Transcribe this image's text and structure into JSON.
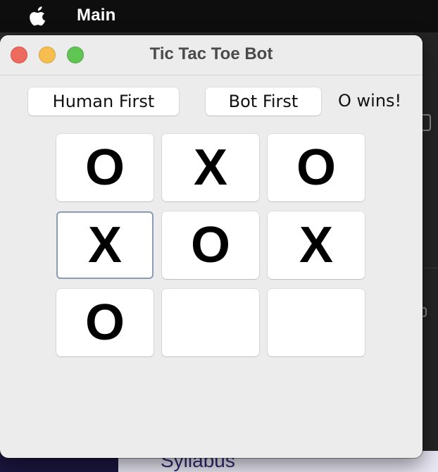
{
  "menubar": {
    "app_name": "Main",
    "apple_icon": "apple-logo-icon"
  },
  "background": {
    "bottom_text": "Syllabus"
  },
  "window": {
    "title": "Tic Tac Toe Bot",
    "controls": {
      "close": "close-window-icon",
      "minimize": "minimize-window-icon",
      "zoom": "zoom-window-icon"
    }
  },
  "toolbar": {
    "human_first_label": "Human First",
    "bot_first_label": "Bot First",
    "status_text": "O wins!"
  },
  "board": {
    "cells": [
      "O",
      "X",
      "O",
      "X",
      "O",
      "X",
      "O",
      "",
      ""
    ],
    "focused_cell": 3
  },
  "colors": {
    "window_bg": "#ececec",
    "cell_bg": "#ffffff",
    "focus_ring": "#8a9bb3",
    "traffic_close": "#ee6a5e",
    "traffic_minimize": "#f5be4f",
    "traffic_zoom": "#61c554"
  }
}
